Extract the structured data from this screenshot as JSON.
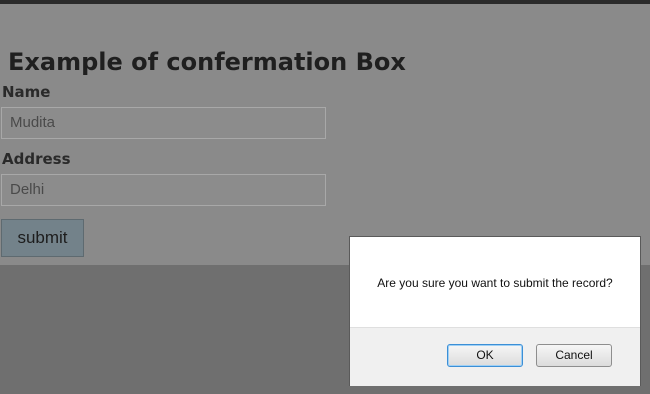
{
  "page": {
    "heading": "Example of confermation Box",
    "form": {
      "name_label": "Name",
      "name_value": "Mudita",
      "address_label": "Address",
      "address_value": "Delhi",
      "submit_label": "submit"
    }
  },
  "dialog": {
    "message": "Are you sure you want to submit the record?",
    "ok_label": "OK",
    "cancel_label": "Cancel"
  }
}
